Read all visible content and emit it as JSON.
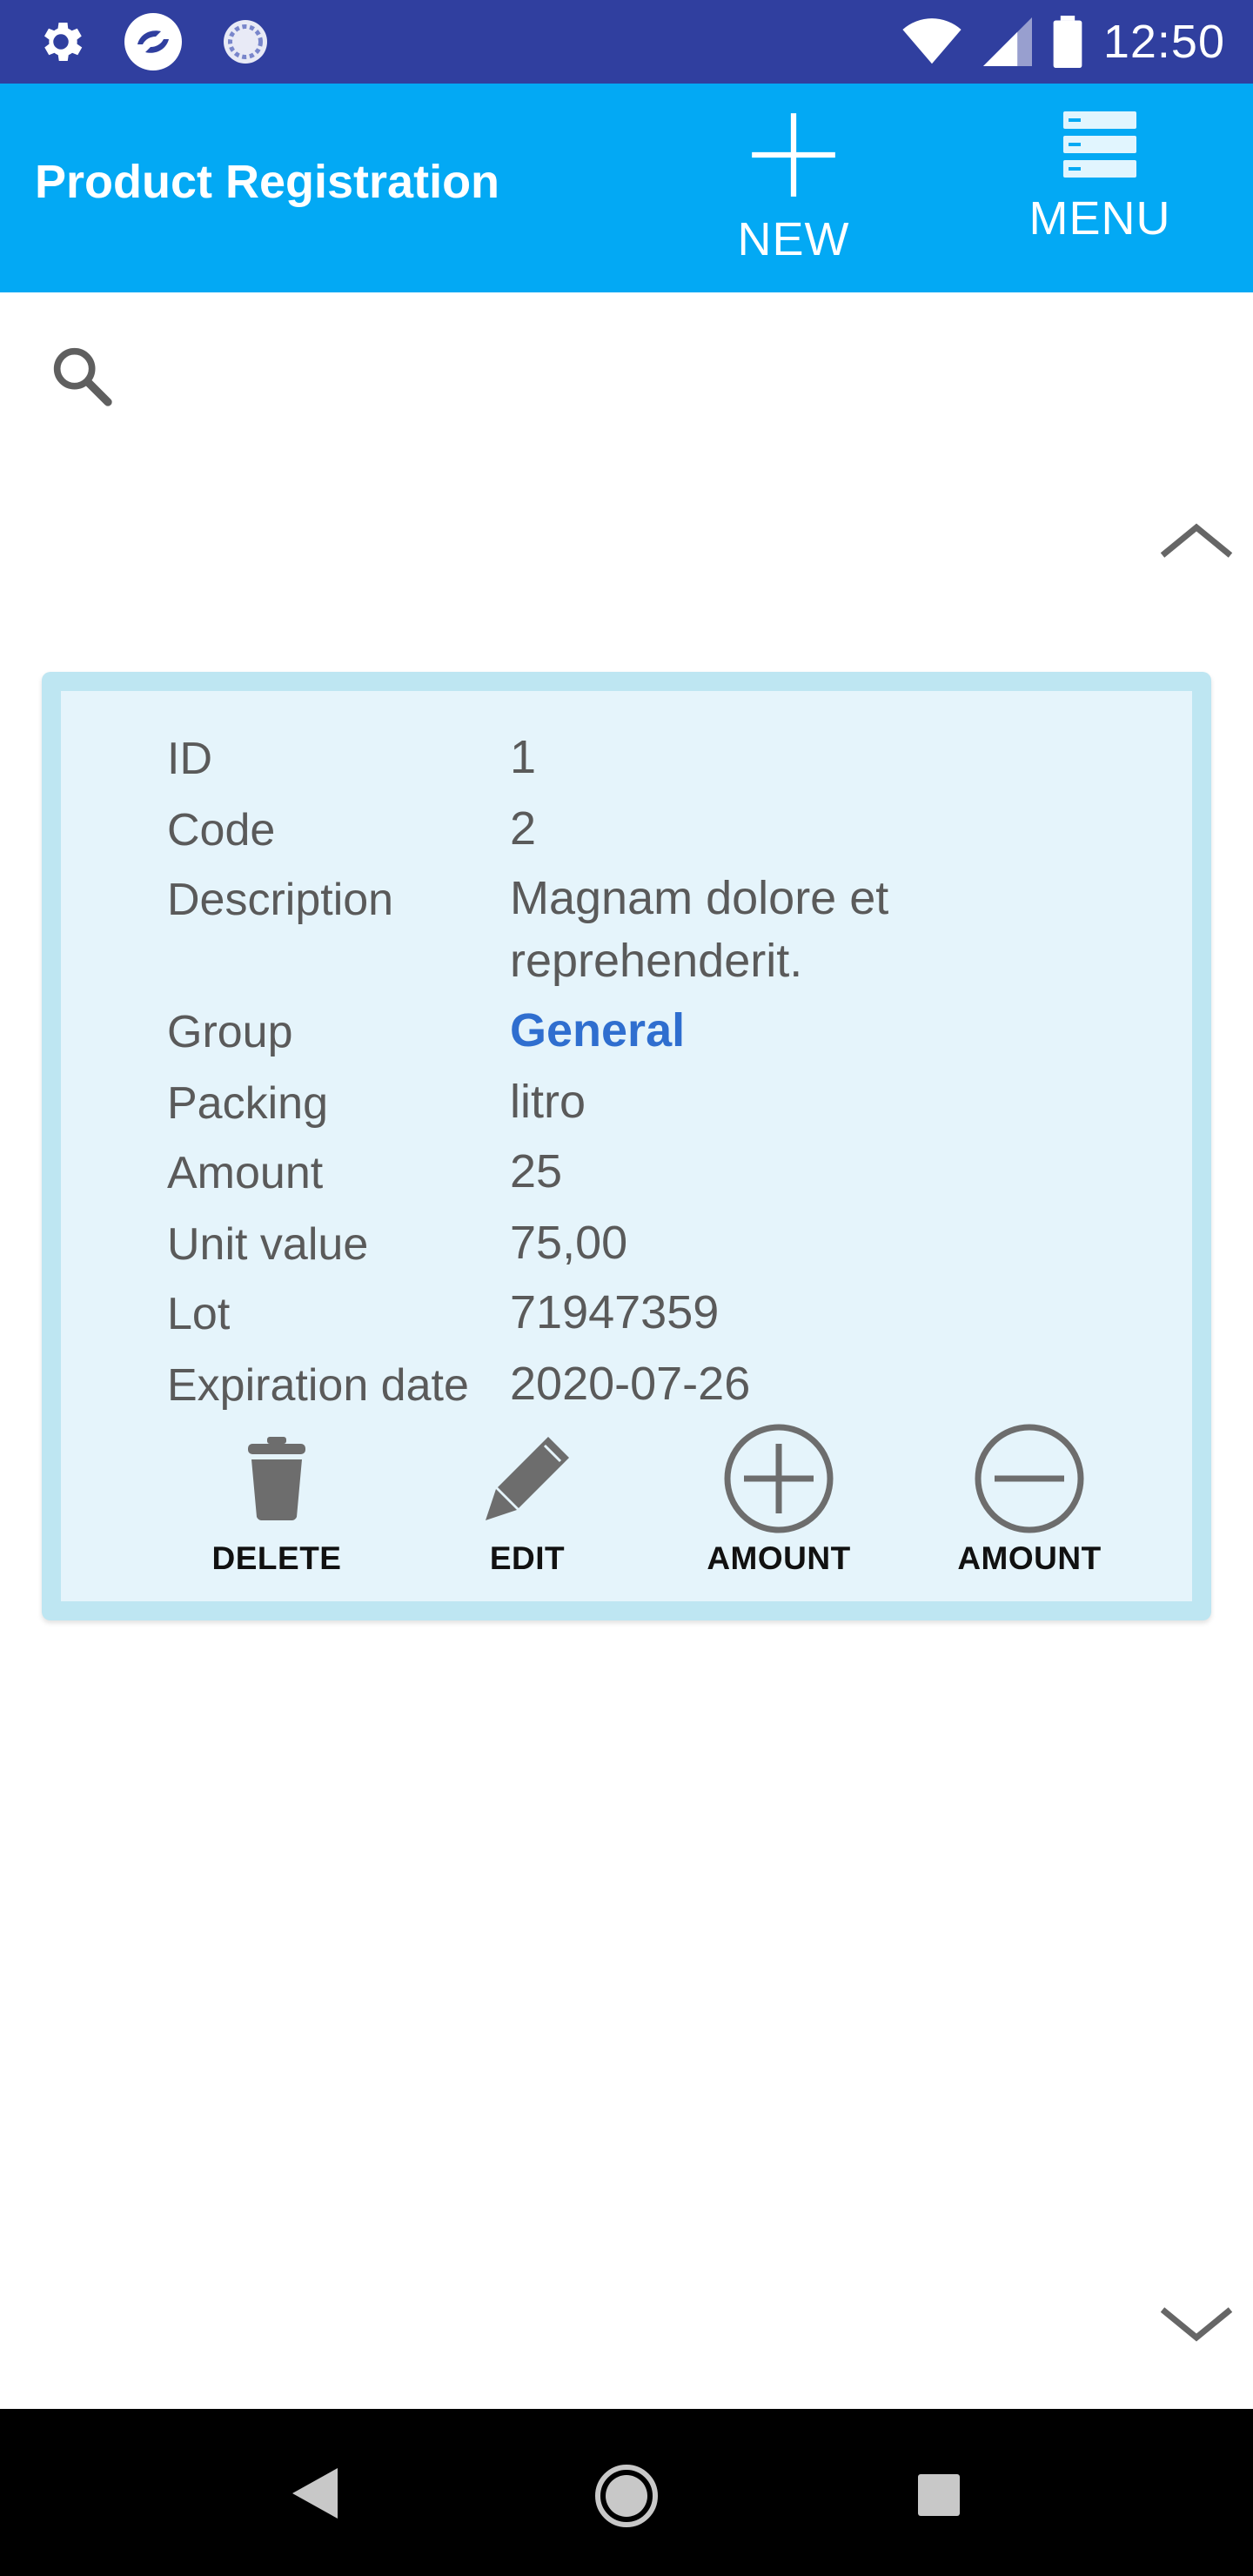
{
  "status_bar": {
    "time": "12:50",
    "icons_left": [
      "gear-icon",
      "app-icon",
      "sync-icon"
    ],
    "icons_right": [
      "wifi-icon",
      "signal-icon",
      "battery-icon"
    ]
  },
  "app_bar": {
    "title": "Product Registration",
    "actions": [
      {
        "label": "NEW",
        "icon": "plus-icon"
      },
      {
        "label": "MENU",
        "icon": "menu-list-icon"
      }
    ]
  },
  "search": {
    "icon": "search-icon"
  },
  "product": {
    "fields": [
      {
        "label": "ID",
        "value": "1"
      },
      {
        "label": "Code",
        "value": "2"
      },
      {
        "label": "Description",
        "value_line1": "Magnam dolore et",
        "value_line2": "reprehenderit."
      },
      {
        "label": "Group",
        "value": "General"
      },
      {
        "label": "Packing",
        "value": "litro"
      },
      {
        "label": "Amount",
        "value": "25"
      },
      {
        "label": "Unit value",
        "value": "75,00"
      },
      {
        "label": "Lot",
        "value": "71947359"
      },
      {
        "label": "Expiration date",
        "value": "2020-07-26"
      }
    ],
    "actions": [
      {
        "label": "DELETE",
        "icon": "trash-icon"
      },
      {
        "label": "EDIT",
        "icon": "pencil-icon"
      },
      {
        "label": "AMOUNT",
        "icon": "plus-circle-icon"
      },
      {
        "label": "AMOUNT",
        "icon": "minus-circle-icon"
      }
    ]
  },
  "colors": {
    "status_bar": "#303F9F",
    "app_bar": "#03A9F4",
    "card_border": "#BEE6F2",
    "card_bg": "#E5F4FB",
    "link": "#2F6ECF",
    "icon_gray": "#6d6d6d"
  }
}
